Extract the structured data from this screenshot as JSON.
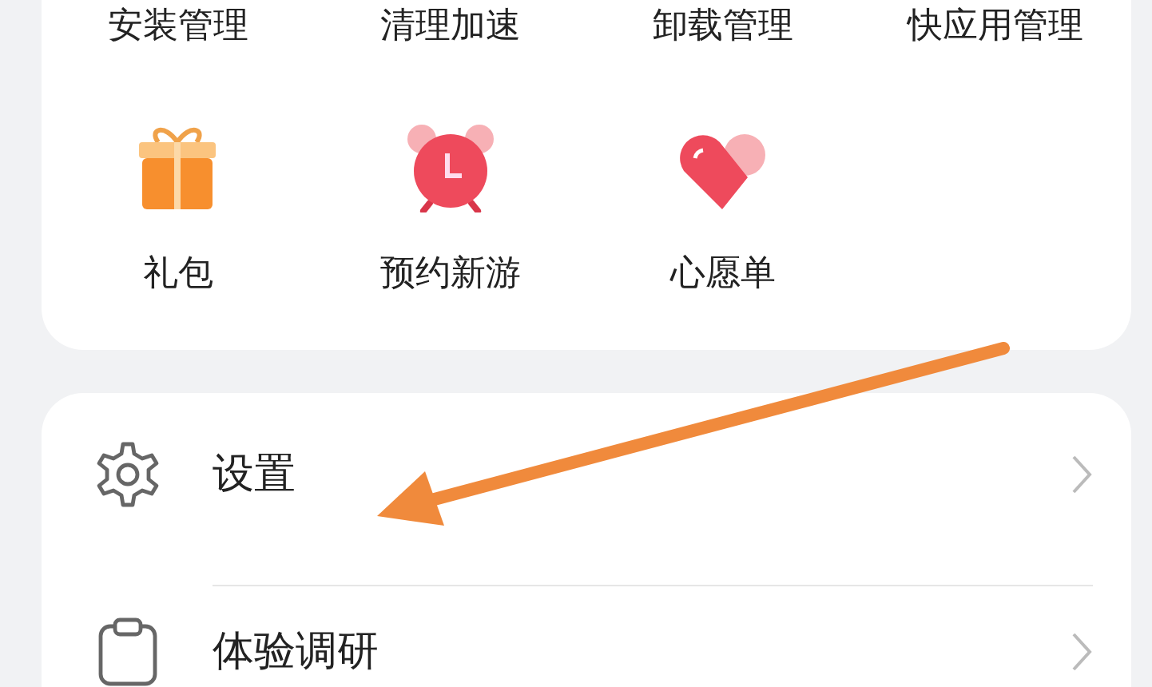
{
  "tools_top": [
    {
      "label": "安装管理"
    },
    {
      "label": "清理加速"
    },
    {
      "label": "卸载管理"
    },
    {
      "label": "快应用管理"
    }
  ],
  "tools": [
    {
      "label": "礼包",
      "kind": "gift"
    },
    {
      "label": "预约新游",
      "kind": "alarm"
    },
    {
      "label": "心愿单",
      "kind": "heart"
    }
  ],
  "menu": [
    {
      "label": "设置",
      "kind": "settings"
    },
    {
      "label": "体验调研",
      "kind": "survey"
    }
  ]
}
